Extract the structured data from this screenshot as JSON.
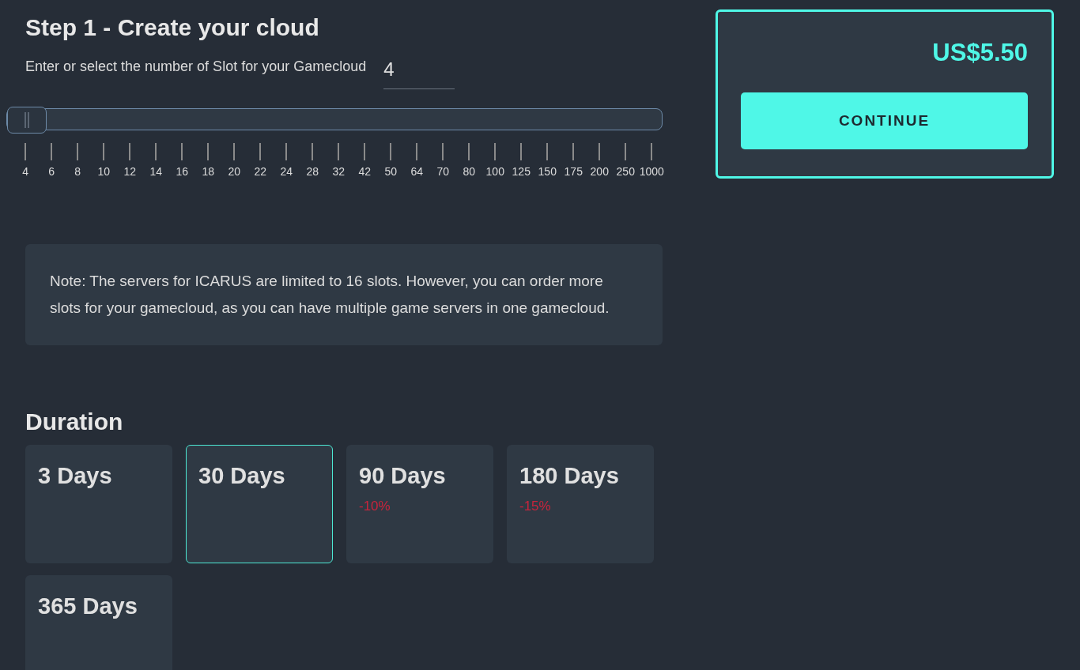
{
  "step": {
    "title": "Step 1 - Create your cloud",
    "prompt": "Enter or select the number of Slot for your Gamecloud",
    "slots_value": "4"
  },
  "slider": {
    "level": 0,
    "ticks": [
      "4",
      "6",
      "8",
      "10",
      "12",
      "14",
      "16",
      "18",
      "20",
      "22",
      "24",
      "28",
      "32",
      "42",
      "50",
      "64",
      "70",
      "80",
      "100",
      "125",
      "150",
      "175",
      "200",
      "250",
      "1000"
    ]
  },
  "note": "Note: The servers for ICARUS are limited to 16 slots. However, you can order more slots for your gamecloud, as you can have multiple game servers in one gamecloud.",
  "duration": {
    "title": "Duration",
    "options": [
      {
        "label": "3 Days",
        "selected": false
      },
      {
        "label": "30 Days",
        "selected": true
      },
      {
        "label": "90 Days",
        "discount": "-10%",
        "selected": false
      },
      {
        "label": "180 Days",
        "discount": "-15%",
        "selected": false
      },
      {
        "label": "365 Days",
        "selected": false
      }
    ]
  },
  "summary": {
    "price": "US$5.50",
    "button": "CONTINUE"
  }
}
